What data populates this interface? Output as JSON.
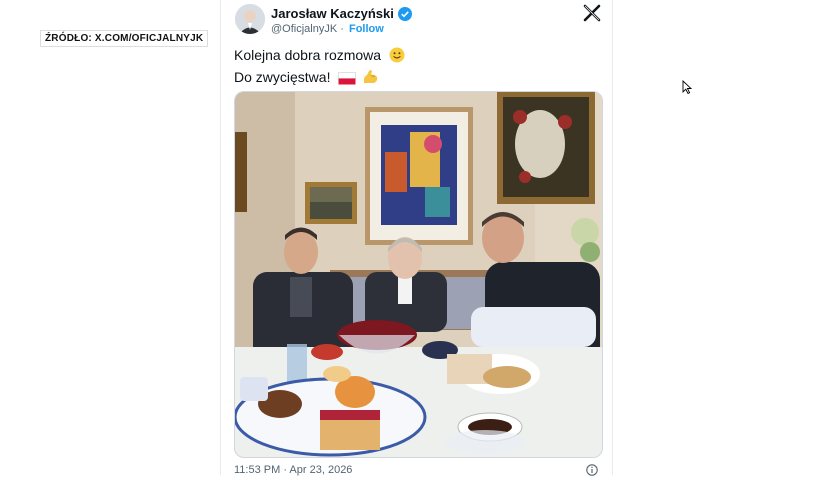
{
  "source_label": "ŹRÓDŁO: X.COM/OFICJALNYJK",
  "tweet": {
    "display_name": "Jarosław Kaczyński",
    "handle": "@OficjalnyJK",
    "separator": "·",
    "follow_label": "Follow",
    "text_lines": [
      "Kolejna dobra rozmowa",
      "Do zwycięstwa!"
    ],
    "timestamp": "11:53 PM · Apr 23, 2026"
  },
  "icons": {
    "verified": "verified-badge-icon",
    "platform": "x-logo-icon",
    "smile": "smiling-face-emoji",
    "flag": "poland-flag-emoji",
    "flex": "flexed-biceps-emoji",
    "info": "info-icon",
    "cursor": "mouse-cursor-icon"
  },
  "colors": {
    "accent": "#1d9bf0",
    "text": "#0f1419",
    "muted": "#536471"
  }
}
